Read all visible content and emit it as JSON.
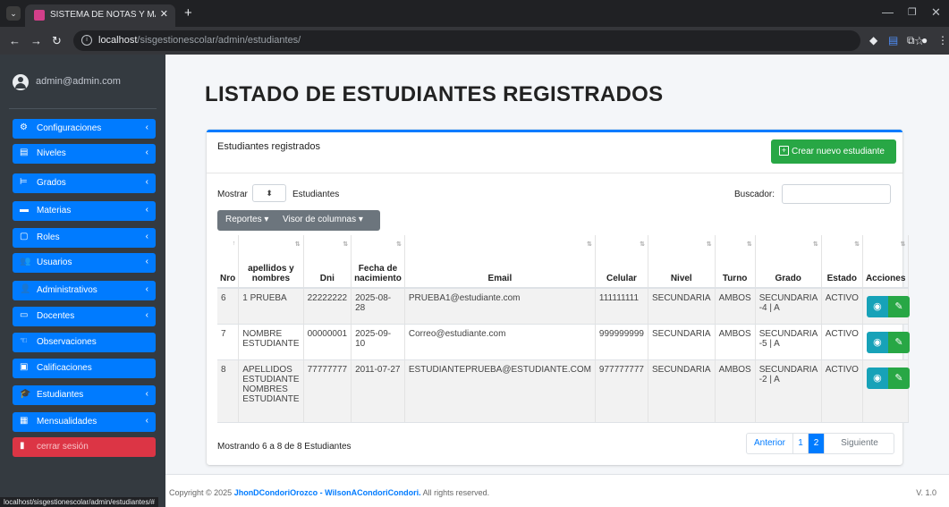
{
  "browser": {
    "tab_title": "SISTEMA DE NOTAS Y MATRICU",
    "url_host": "localhost",
    "url_path": "/sisgestionescolar/admin/estudiantes/",
    "status_url": "localhost/sisgestionescolar/admin/estudiantes/#"
  },
  "sidebar": {
    "user": "admin@admin.com",
    "items": [
      {
        "label": "Configuraciones",
        "icon": "⚙",
        "chevron": true
      },
      {
        "label": "Niveles",
        "icon": "▤",
        "chevron": true
      },
      {
        "label": "Grados",
        "icon": "⊨",
        "chevron": true
      },
      {
        "label": "Materias",
        "icon": "▬",
        "chevron": true
      },
      {
        "label": "Roles",
        "icon": "▢",
        "chevron": true
      },
      {
        "label": "Usuarios",
        "icon": "👥",
        "chevron": true
      },
      {
        "label": "Administrativos",
        "icon": "👤",
        "chevron": true
      },
      {
        "label": "Docentes",
        "icon": "▭",
        "chevron": true
      },
      {
        "label": "Observaciones",
        "icon": "☜",
        "chevron": false
      },
      {
        "label": "Calificaciones",
        "icon": "▣",
        "chevron": false
      },
      {
        "label": "Estudiantes",
        "icon": "🎓",
        "chevron": true
      },
      {
        "label": "Mensualidades",
        "icon": "▦",
        "chevron": true
      }
    ],
    "logout": "cerrar sesión"
  },
  "page": {
    "title": "LISTADO DE ESTUDIANTES REGISTRADOS"
  },
  "card": {
    "title": "Estudiantes registrados",
    "create_button": "Crear nuevo estudiante",
    "show_label": "Mostrar",
    "show_suffix": "Estudiantes",
    "search_label": "Buscador:",
    "search_value": "",
    "reports_button": "Reportes",
    "columns_button": "Visor de columnas"
  },
  "table": {
    "headers": [
      "Nro",
      "apellidos y nombres",
      "Dni",
      "Fecha de nacimiento",
      "Email",
      "Celular",
      "Nivel",
      "Turno",
      "Grado",
      "Estado",
      "Acciones"
    ],
    "rows": [
      {
        "nro": "6",
        "nombre": "1 PRUEBA",
        "dni": "22222222",
        "fecha": "2025-08-28",
        "email": "PRUEBA1@estudiante.com",
        "celular": "111111111",
        "nivel": "SECUNDARIA",
        "turno": "AMBOS",
        "grado": "SECUNDARIA -4 | A",
        "estado": "ACTIVO"
      },
      {
        "nro": "7",
        "nombre": "NOMBRE ESTUDIANTE",
        "dni": "00000001",
        "fecha": "2025-09-10",
        "email": "Correo@estudiante.com",
        "celular": "999999999",
        "nivel": "SECUNDARIA",
        "turno": "AMBOS",
        "grado": "SECUNDARIA -5 | A",
        "estado": "ACTIVO"
      },
      {
        "nro": "8",
        "nombre": "APELLIDOS ESTUDIANTE NOMBRES ESTUDIANTE",
        "dni": "77777777",
        "fecha": "2011-07-27",
        "email": "ESTUDIANTEPRUEBA@ESTUDIANTE.COM",
        "celular": "977777777",
        "nivel": "SECUNDARIA",
        "turno": "AMBOS",
        "grado": "SECUNDARIA -2 | A",
        "estado": "ACTIVO"
      }
    ]
  },
  "pagination": {
    "info": "Mostrando 6 a 8 de 8 Estudiantes",
    "prev": "Anterior",
    "pages": [
      "1",
      "2"
    ],
    "active_page": "2",
    "next": "Siguiente"
  },
  "footer": {
    "copyright": "Copyright © 2025",
    "authors": "JhonDCondoriOrozco - WilsonACondoriCondori.",
    "rights": "All rights reserved.",
    "version": "V. 1.0"
  },
  "colors": {
    "primary": "#007bff",
    "success": "#28a745",
    "danger": "#dc3545",
    "info": "#17a2b8",
    "sidebar": "#343a40"
  }
}
